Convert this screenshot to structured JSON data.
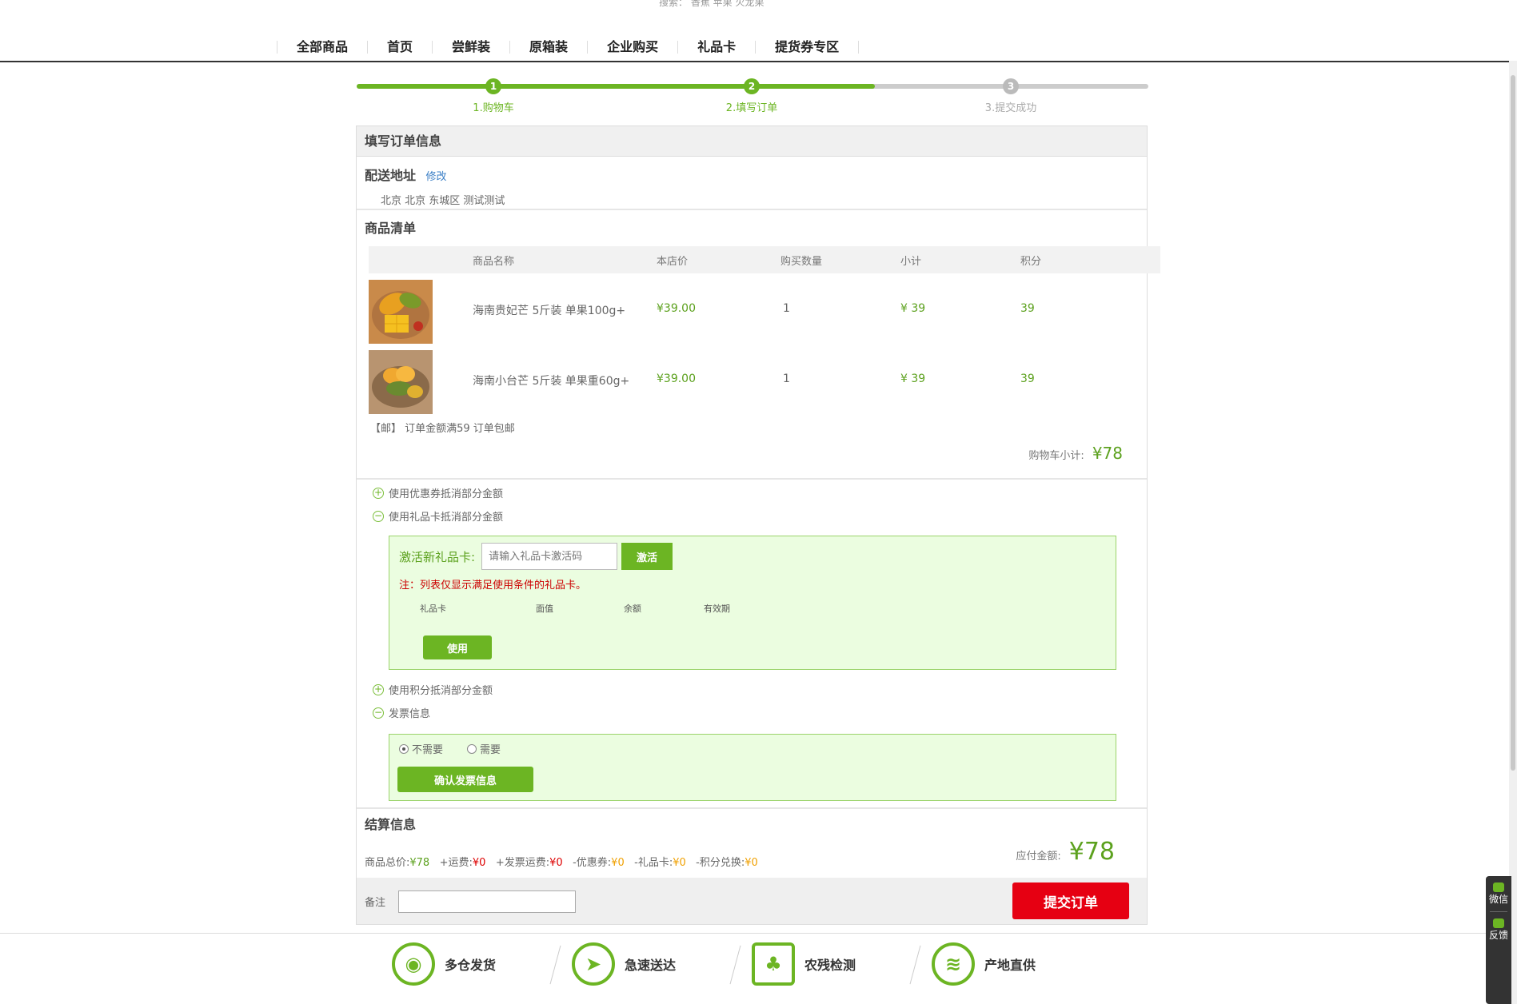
{
  "top_hint": "搜索：  香蕉 苹果 火龙果",
  "nav": [
    "全部商品",
    "首页",
    "尝鲜装",
    "原箱装",
    "企业购买",
    "礼品卡",
    "提货券专区"
  ],
  "steps": [
    {
      "num": "1",
      "label": "1.购物车",
      "active": true
    },
    {
      "num": "2",
      "label": "2.填写订单",
      "active": true
    },
    {
      "num": "3",
      "label": "3.提交成功",
      "active": false
    }
  ],
  "order": {
    "title": "填写订单信息",
    "address_title": "配送地址",
    "address_edit": "修改",
    "address": "北京 北京 东城区 测试测试",
    "goods_title": "商品清单",
    "columns": {
      "name": "商品名称",
      "price": "本店价",
      "qty": "购买数量",
      "subtotal": "小计",
      "points": "积分"
    },
    "items": [
      {
        "name": "海南贵妃芒 5斤装 单果100g+",
        "price": "¥39.00",
        "qty": "1",
        "subtotal": "¥ 39",
        "points": "39"
      },
      {
        "name": "海南小台芒 5斤装 单果重60g+",
        "price": "¥39.00",
        "qty": "1",
        "subtotal": "¥ 39",
        "points": "39"
      }
    ],
    "free_shipping": "【邮】 订单金额满59 订单包邮",
    "cart_total_label": "购物车小计:",
    "cart_total": "¥78"
  },
  "options": {
    "coupon": "使用优惠券抵消部分金额",
    "giftcard": "使用礼品卡抵消部分金额",
    "points": "使用积分抵消部分金额",
    "invoice": "发票信息"
  },
  "giftcard": {
    "label": "激活新礼品卡:",
    "placeholder": "请输入礼品卡激活码",
    "activate": "激活",
    "note": "注：列表仅显示满足使用条件的礼品卡。",
    "cols": [
      "礼品卡",
      "面值",
      "余额",
      "有效期"
    ],
    "use": "使用"
  },
  "invoice": {
    "no": "不需要",
    "yes": "需要",
    "confirm": "确认发票信息"
  },
  "settle": {
    "title": "结算信息",
    "goods_total_label": "商品总价:",
    "goods_total": "¥78",
    "shipping_label": "+运费:",
    "shipping": "¥0",
    "inv_ship_label": "+发票运费:",
    "inv_ship": "¥0",
    "coupon_label": "-优惠券:",
    "coupon": "¥0",
    "giftcard_label": "-礼品卡:",
    "giftcard": "¥0",
    "points_label": "-积分兑换:",
    "points": "¥0",
    "payable_label": "应付金额:",
    "payable": "¥78",
    "remark_label": "备注",
    "submit": "提交订单"
  },
  "features": [
    "多仓发货",
    "急速送达",
    "农残检测",
    "产地直供"
  ],
  "side": [
    {
      "label": "微信"
    },
    {
      "label": "反馈"
    }
  ],
  "colors": {
    "accent": "#6cb523",
    "submit": "#e60012",
    "box_bg": "#ebfde0"
  }
}
